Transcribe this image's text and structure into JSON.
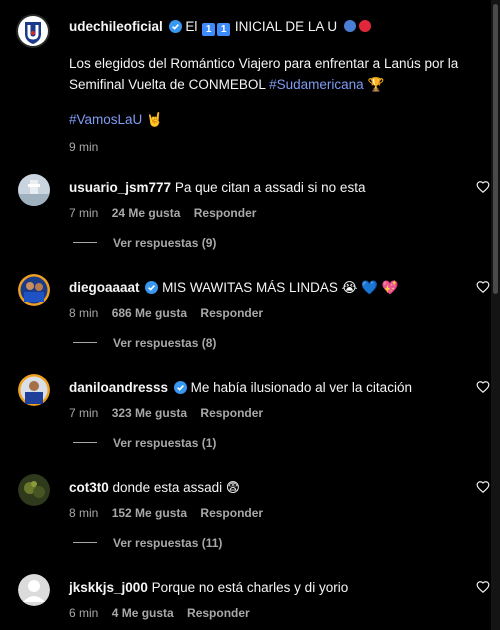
{
  "post": {
    "username": "udechileoficial",
    "title_prefix": "El",
    "title_badges": [
      "1",
      "1"
    ],
    "title_text": "INICIAL DE LA U",
    "caption_text": "Los elegidos del Romántico Viajero para enfrentar a Lanús por la Semifinal Vuelta de CONMEBOL",
    "caption_hashtag": "#Sudamericana",
    "caption_trophy": "🏆",
    "hashtag2": "#VamosLaU",
    "hashtag2_emoji": "🤘",
    "time": "9 min"
  },
  "comments": [
    {
      "username": "usuario_jsm777",
      "text": "Pa que citan a assadi si no esta",
      "verified": false,
      "time": "7 min",
      "likes": "24 Me gusta",
      "reply_label": "Responder",
      "replies": "Ver respuestas (9)"
    },
    {
      "username": "diegoaaaat",
      "text": "MIS WAWITAS MÁS LINDAS",
      "emojis": "😭 💙 💖",
      "verified": true,
      "time": "8 min",
      "likes": "686 Me gusta",
      "reply_label": "Responder",
      "replies": "Ver respuestas (8)"
    },
    {
      "username": "daniloandresss",
      "text": "Me había ilusionado al ver la citación",
      "verified": true,
      "time": "7 min",
      "likes": "323 Me gusta",
      "reply_label": "Responder",
      "replies": "Ver respuestas (1)"
    },
    {
      "username": "cot3t0",
      "text": "donde esta assadi",
      "emojis": "😨",
      "verified": false,
      "time": "8 min",
      "likes": "152 Me gusta",
      "reply_label": "Responder",
      "replies": "Ver respuestas (11)"
    },
    {
      "username": "jkskkjs_j000",
      "text": "Porque no está charles y di yorio",
      "verified": false,
      "time": "6 min",
      "likes": "4 Me gusta",
      "reply_label": "Responder"
    }
  ],
  "colors": {
    "background": "#000000",
    "text": "#f5f5f5",
    "secondary": "#a8a8a8",
    "hashtag": "#7f9cf5",
    "verified": "#3897f0"
  }
}
